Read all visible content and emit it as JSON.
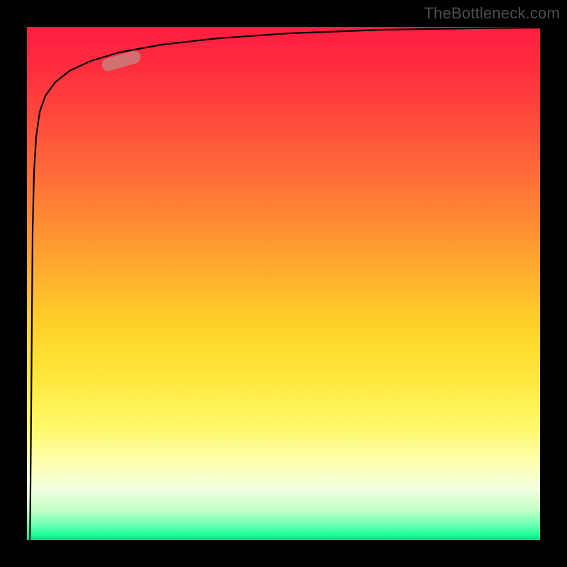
{
  "attribution": "TheBottleneck.com",
  "chart_data": {
    "type": "line",
    "title": "",
    "xlabel": "",
    "ylabel": "",
    "xlim": [
      0,
      100
    ],
    "ylim": [
      0,
      100
    ],
    "grid": false,
    "legend": false,
    "background_gradient": {
      "direction": "vertical",
      "stops": [
        {
          "pos": 0.0,
          "color": "#ff1d40"
        },
        {
          "pos": 0.18,
          "color": "#ff4a3c"
        },
        {
          "pos": 0.38,
          "color": "#ff8a33"
        },
        {
          "pos": 0.58,
          "color": "#ffd12a"
        },
        {
          "pos": 0.78,
          "color": "#fff86a"
        },
        {
          "pos": 0.9,
          "color": "#f2ffe0"
        },
        {
          "pos": 0.97,
          "color": "#6effb5"
        },
        {
          "pos": 1.0,
          "color": "#00db83"
        }
      ]
    },
    "series": [
      {
        "name": "curve",
        "x": [
          0.6,
          0.8,
          1.0,
          1.3,
          1.7,
          2.2,
          3.0,
          4.0,
          5.5,
          8.0,
          12,
          18,
          26,
          36,
          48,
          62,
          78,
          92,
          100
        ],
        "y": [
          0,
          10,
          25,
          45,
          62,
          74,
          82,
          86,
          89,
          91,
          93,
          95,
          96,
          97,
          98,
          98.6,
          99.1,
          99.5,
          99.8
        ]
      }
    ],
    "highlight_range": {
      "series": "curve",
      "x_start": 12,
      "x_end": 22
    }
  }
}
